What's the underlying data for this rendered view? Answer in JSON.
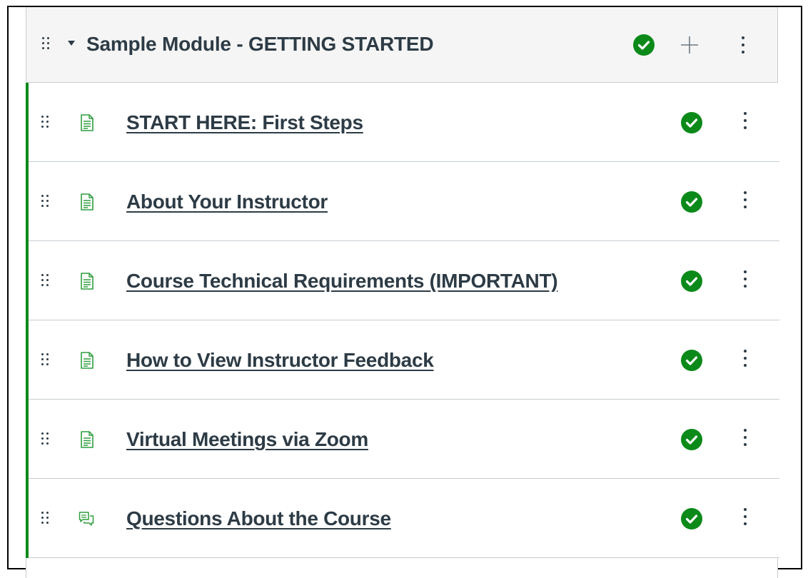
{
  "module": {
    "title": "Sample Module - GETTING STARTED",
    "status_icon": "check-circle-icon",
    "add_icon": "plus-icon",
    "options_icon": "kebab-icon"
  },
  "items": [
    {
      "title": "START HERE: First Steps",
      "type": "page",
      "icon": "page-icon",
      "status": "completed"
    },
    {
      "title": "About Your Instructor",
      "type": "page",
      "icon": "page-icon",
      "status": "completed"
    },
    {
      "title": "Course Technical Requirements (IMPORTANT)",
      "type": "page",
      "icon": "page-icon",
      "status": "completed"
    },
    {
      "title": "How to View Instructor Feedback",
      "type": "page",
      "icon": "page-icon",
      "status": "completed"
    },
    {
      "title": "Virtual Meetings via Zoom",
      "type": "page",
      "icon": "page-icon",
      "status": "completed"
    },
    {
      "title": "Questions About the Course",
      "type": "discussion",
      "icon": "discussion-icon",
      "status": "completed"
    }
  ],
  "colors": {
    "accent": "#0b8a1a",
    "text": "#2d3b45",
    "header_bg": "#f5f5f5",
    "border": "#c7cdd1",
    "page_icon": "#2e9e3e"
  }
}
